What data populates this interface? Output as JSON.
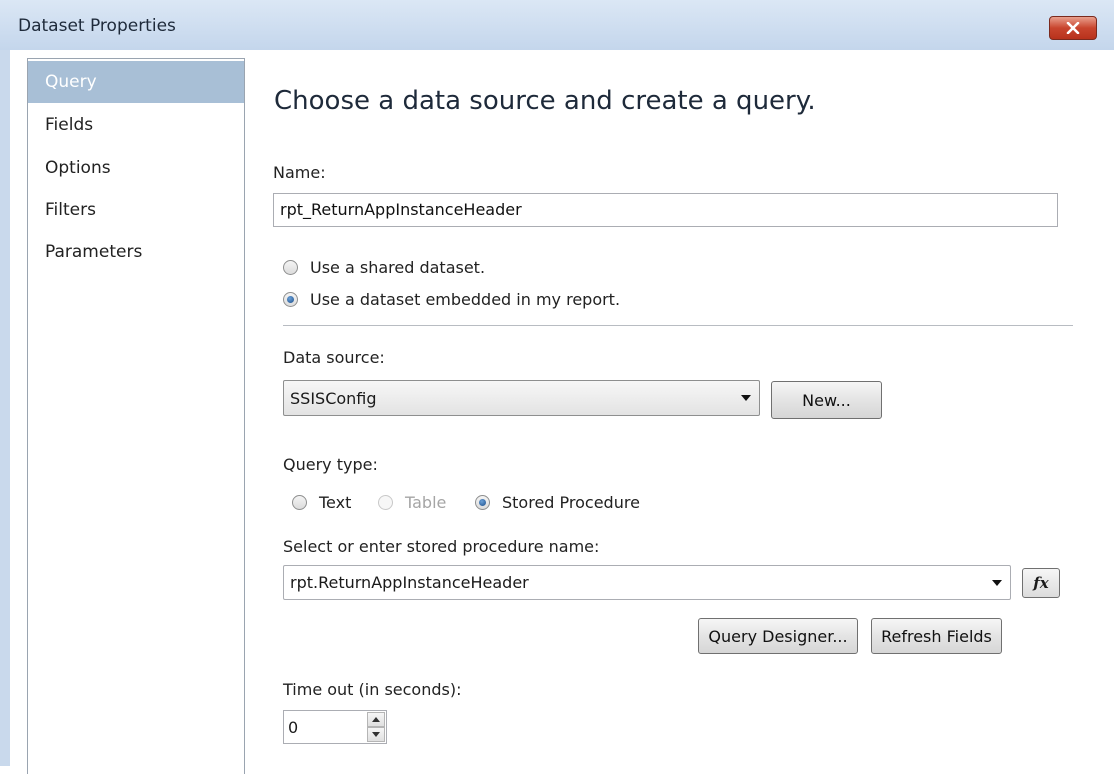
{
  "window": {
    "title": "Dataset Properties"
  },
  "sidebar": {
    "items": [
      {
        "label": "Query",
        "selected": true
      },
      {
        "label": "Fields"
      },
      {
        "label": "Options"
      },
      {
        "label": "Filters"
      },
      {
        "label": "Parameters"
      }
    ]
  },
  "main": {
    "heading": "Choose a data source and create a query.",
    "name_label": "Name:",
    "name_value": "rpt_ReturnAppInstanceHeader",
    "dataset_mode": {
      "shared_label": "Use a shared dataset.",
      "embedded_label": "Use a dataset embedded in my report.",
      "selected": "embedded"
    },
    "data_source_label": "Data source:",
    "data_source_value": "SSISConfig",
    "new_button": "New...",
    "query_type_label": "Query type:",
    "query_type": {
      "text_label": "Text",
      "table_label": "Table",
      "stored_procedure_label": "Stored Procedure",
      "selected": "stored_procedure"
    },
    "stored_proc_label": "Select or enter stored procedure name:",
    "stored_proc_value": "rpt.ReturnAppInstanceHeader",
    "fx_button": "fx",
    "query_designer_button": "Query Designer...",
    "refresh_fields_button": "Refresh Fields",
    "timeout_label": "Time out (in seconds):",
    "timeout_value": "0"
  },
  "colors": {
    "titlebar": "#c9d9ec",
    "selected_nav": "#a8bfd6",
    "close_button": "#c8452e"
  }
}
